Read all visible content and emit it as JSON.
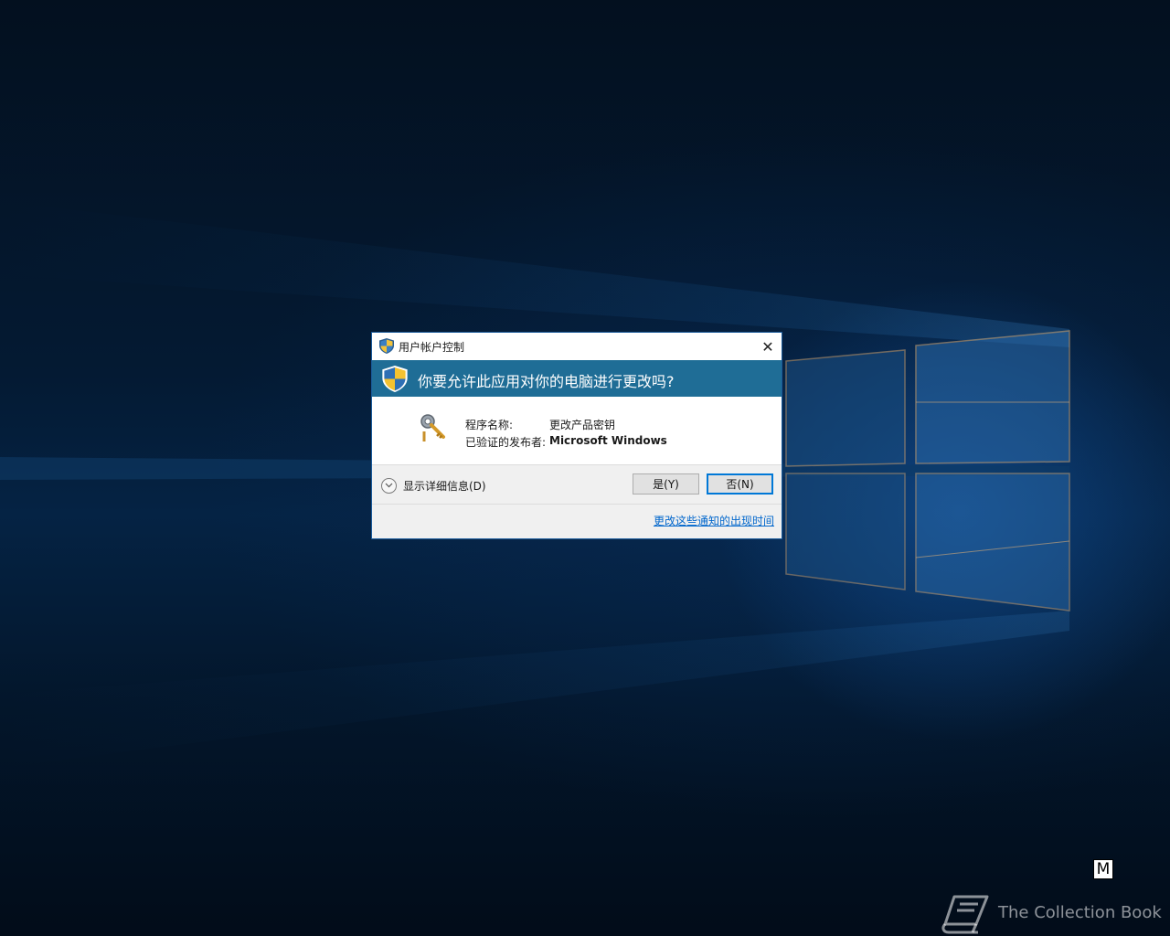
{
  "dialog": {
    "title": "用户帐户控制",
    "question": "你要允许此应用对你的电脑进行更改吗?",
    "program_label": "程序名称:",
    "program_value": "更改产品密钥",
    "publisher_label": "已验证的发布者:",
    "publisher_value": "Microsoft Windows",
    "details_label": "显示详细信息(D)",
    "yes_label": "是(Y)",
    "no_label": "否(N)",
    "notify_link": "更改这些通知的出现时间",
    "close_glyph": "✕"
  },
  "overlay": {
    "key_badge": "M",
    "watermark": "The Collection Book"
  },
  "colors": {
    "banner": "#1f6d96",
    "link": "#0066cc",
    "focus_border": "#0078d7"
  },
  "icons": [
    "uac-shield-icon",
    "key-icon",
    "chevron-down-icon",
    "close-icon",
    "book-icon"
  ]
}
